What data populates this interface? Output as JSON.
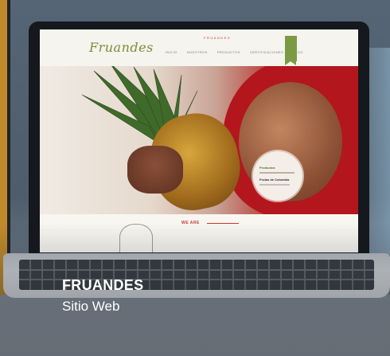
{
  "project": {
    "title": "FRUANDES",
    "subtitle": "Sitio Web"
  },
  "screen_site": {
    "logo": "Fruandes",
    "nav_top": "FRUANDES",
    "nav_items": [
      "INICIO",
      "NOSOTROS",
      "PRODUCTOS",
      "CERTIFICACIONES",
      "BLOG"
    ],
    "promo_line1": "Productos",
    "promo_line3": "Frutas de Colombia",
    "we_are": "WE ARE"
  },
  "colors": {
    "accent_green": "#7c9a43",
    "accent_red": "#c7382b",
    "left_strip": "#c08a2a"
  }
}
